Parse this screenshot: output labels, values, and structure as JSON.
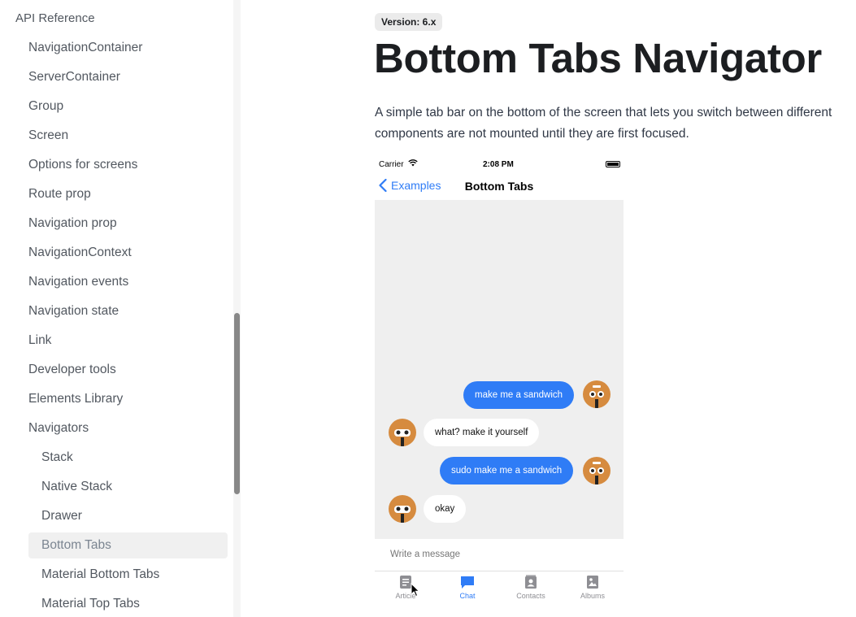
{
  "sidebar": {
    "section_title": "API Reference",
    "items": [
      {
        "label": "NavigationContainer"
      },
      {
        "label": "ServerContainer"
      },
      {
        "label": "Group"
      },
      {
        "label": "Screen"
      },
      {
        "label": "Options for screens"
      },
      {
        "label": "Route prop"
      },
      {
        "label": "Navigation prop"
      },
      {
        "label": "NavigationContext"
      },
      {
        "label": "Navigation events"
      },
      {
        "label": "Navigation state"
      },
      {
        "label": "Link"
      },
      {
        "label": "Developer tools"
      },
      {
        "label": "Elements Library"
      },
      {
        "label": "Navigators"
      }
    ],
    "sub_items": [
      {
        "label": "Stack"
      },
      {
        "label": "Native Stack"
      },
      {
        "label": "Drawer"
      },
      {
        "label": "Bottom Tabs",
        "active": true
      },
      {
        "label": "Material Bottom Tabs"
      },
      {
        "label": "Material Top Tabs"
      }
    ]
  },
  "main": {
    "version_badge": "Version: 6.x",
    "title": "Bottom Tabs Navigator",
    "description_line1": "A simple tab bar on the bottom of the screen that lets you switch between different",
    "description_line2": "components are not mounted until they are first focused."
  },
  "phone": {
    "status": {
      "carrier": "Carrier",
      "time": "2:08 PM"
    },
    "nav": {
      "back_label": "Examples",
      "title": "Bottom Tabs"
    },
    "messages": [
      {
        "text": "make me a sandwich",
        "from": "me"
      },
      {
        "text": "what? make it yourself",
        "from": "bot"
      },
      {
        "text": "sudo make me a sandwich",
        "from": "me"
      },
      {
        "text": "okay",
        "from": "bot"
      }
    ],
    "composer_placeholder": "Write a message",
    "tabs": [
      {
        "label": "Article",
        "icon": "article-icon"
      },
      {
        "label": "Chat",
        "icon": "chat-icon",
        "active": true
      },
      {
        "label": "Contacts",
        "icon": "contacts-icon"
      },
      {
        "label": "Albums",
        "icon": "albums-icon"
      }
    ]
  },
  "colors": {
    "accent": "#2f7cf6",
    "avatar": "#d68b3f",
    "chat_bg": "#efefef"
  }
}
